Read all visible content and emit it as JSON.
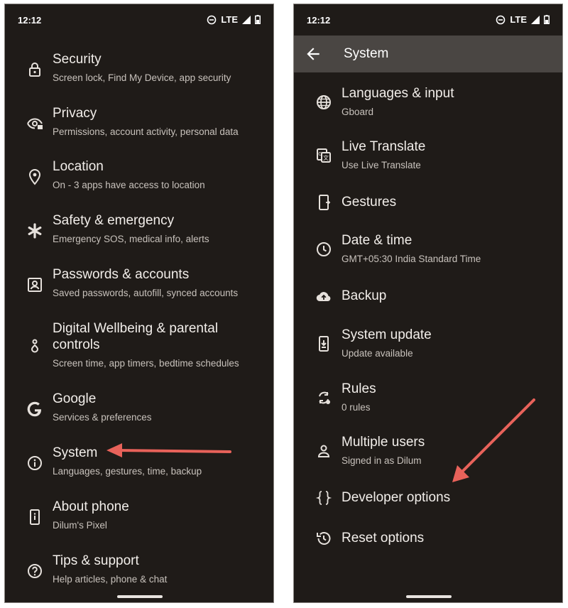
{
  "left_screen": {
    "status": {
      "time": "12:12",
      "network": "LTE"
    },
    "items": [
      {
        "icon": "lock-icon",
        "title": "Security",
        "subtitle": "Screen lock, Find My Device, app security"
      },
      {
        "icon": "eye-lock-icon",
        "title": "Privacy",
        "subtitle": "Permissions, account activity, personal data"
      },
      {
        "icon": "location-pin-icon",
        "title": "Location",
        "subtitle": "On - 3 apps have access to location"
      },
      {
        "icon": "asterisk-icon",
        "title": "Safety & emergency",
        "subtitle": "Emergency SOS, medical info, alerts"
      },
      {
        "icon": "account-box-icon",
        "title": "Passwords & accounts",
        "subtitle": "Saved passwords, autofill, synced accounts"
      },
      {
        "icon": "wellbeing-icon",
        "title_line1": "Digital Wellbeing & parental",
        "title_line2": "controls",
        "subtitle": "Screen time, app timers, bedtime schedules"
      },
      {
        "icon": "google-g-icon",
        "title": "Google",
        "subtitle": "Services & preferences"
      },
      {
        "icon": "info-icon",
        "title": "System",
        "subtitle": "Languages, gestures, time, backup"
      },
      {
        "icon": "phone-info-icon",
        "title": "About phone",
        "subtitle": "Dilum's Pixel"
      },
      {
        "icon": "help-icon",
        "title": "Tips & support",
        "subtitle": "Help articles, phone & chat"
      }
    ]
  },
  "right_screen": {
    "status": {
      "time": "12:12",
      "network": "LTE"
    },
    "appbar": {
      "title": "System"
    },
    "items": [
      {
        "icon": "globe-icon",
        "title": "Languages & input",
        "subtitle": "Gboard"
      },
      {
        "icon": "translate-icon",
        "title": "Live Translate",
        "subtitle": "Use Live Translate"
      },
      {
        "icon": "gestures-icon",
        "title": "Gestures"
      },
      {
        "icon": "clock-icon",
        "title": "Date & time",
        "subtitle": "GMT+05:30 India Standard Time"
      },
      {
        "icon": "cloud-upload-icon",
        "title": "Backup"
      },
      {
        "icon": "system-update-icon",
        "title": "System update",
        "subtitle": "Update available"
      },
      {
        "icon": "rules-icon",
        "title": "Rules",
        "subtitle": "0 rules"
      },
      {
        "icon": "person-icon",
        "title": "Multiple users",
        "subtitle": "Signed in as Dilum"
      },
      {
        "icon": "braces-icon",
        "title": "Developer options"
      },
      {
        "icon": "history-icon",
        "title": "Reset options"
      }
    ]
  },
  "colors": {
    "background": "#1f1b18",
    "appbar": "#4a4643",
    "arrow": "#e8625a"
  }
}
